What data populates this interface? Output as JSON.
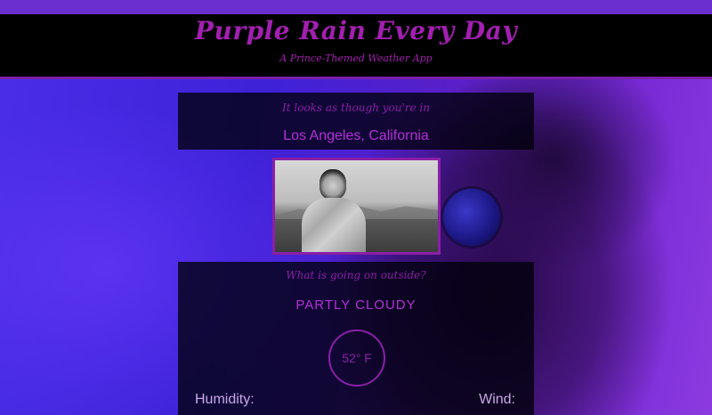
{
  "header": {
    "title": "Purple Rain Every Day",
    "subtitle": "A Prince-Themed Weather App"
  },
  "location": {
    "lead": "It looks as though you're in",
    "city": "Los Angeles, California"
  },
  "conditions": {
    "lead": "What is going on outside?",
    "summary": "PARTLY CLOUDY",
    "temperature": "52° F",
    "humidity_label": "Humidity:",
    "wind_label": "Wind:"
  },
  "colors": {
    "accent": "#a21fb0",
    "background": "#3a1fd6",
    "panel": "#000000"
  }
}
